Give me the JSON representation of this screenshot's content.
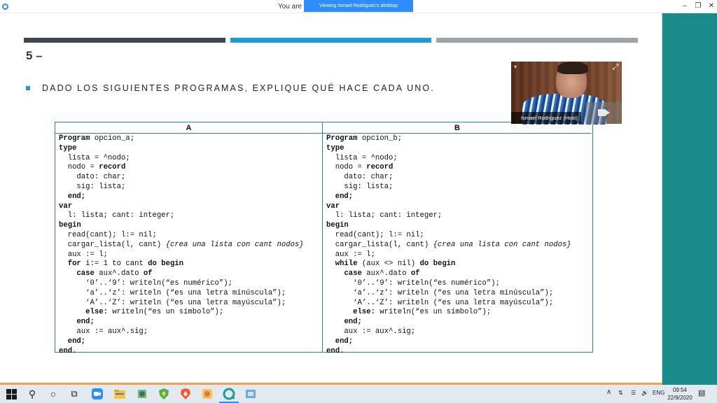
{
  "window": {
    "title_text": "You are v",
    "viewing_banner": "Viewing Ismael Rodriguez's desktop",
    "minimize_glyph": "–",
    "maximize_glyph": "❐",
    "close_glyph": "✕"
  },
  "slide": {
    "number": "5 –",
    "instruction": "DADO LOS SIGUIENTES PROGRAMAS, EXPLIQUE QUÉ HACE CADA UNO.",
    "colors": {
      "bar_dark": "#3f4850",
      "bar_blue": "#1e9ad6",
      "bar_gray": "#9ea3a8",
      "accent": "#1a8b8a"
    }
  },
  "table": {
    "col_a_header": "A",
    "col_b_header": "B",
    "code_a": [
      [
        {
          "t": "Program",
          "k": 1
        },
        {
          "t": " opcion_a;"
        }
      ],
      [
        {
          "t": "type",
          "k": 1
        }
      ],
      [
        {
          "t": "  lista = ^nodo;"
        }
      ],
      [
        {
          "t": "  nodo = "
        },
        {
          "t": "record",
          "k": 1
        }
      ],
      [
        {
          "t": "    dato: char;"
        }
      ],
      [
        {
          "t": "    sig: lista;"
        }
      ],
      [
        {
          "t": "  "
        },
        {
          "t": "end;",
          "k": 1
        }
      ],
      [
        {
          "t": "var",
          "k": 1
        }
      ],
      [
        {
          "t": "  l: lista; cant: integer;"
        }
      ],
      [
        {
          "t": "begin",
          "k": 1
        }
      ],
      [
        {
          "t": "  read(cant); l:= nil;"
        }
      ],
      [
        {
          "t": "  cargar_lista(l, cant) "
        },
        {
          "t": "{crea una lista con cant nodos}",
          "c": 1
        }
      ],
      [
        {
          "t": "  aux := l;"
        }
      ],
      [
        {
          "t": "  "
        },
        {
          "t": "for",
          "k": 1
        },
        {
          "t": " i:= 1 to cant "
        },
        {
          "t": "do begin",
          "k": 1
        }
      ],
      [
        {
          "t": "    "
        },
        {
          "t": "case",
          "k": 1
        },
        {
          "t": " aux^.dato "
        },
        {
          "t": "of",
          "k": 1
        }
      ],
      [
        {
          "t": "      ‘0’..‘9’: writeln(“es numérico”);"
        }
      ],
      [
        {
          "t": "      ‘a’..‘z’: writeln (“es una letra minúscula”);"
        }
      ],
      [
        {
          "t": "      ‘A’..‘Z’: writeln (“es una letra mayúscula”);"
        }
      ],
      [
        {
          "t": "      "
        },
        {
          "t": "else:",
          "k": 1
        },
        {
          "t": " writeln(“es un símbolo”);"
        }
      ],
      [
        {
          "t": "    "
        },
        {
          "t": "end;",
          "k": 1
        }
      ],
      [
        {
          "t": "    aux := aux^.sig;"
        }
      ],
      [
        {
          "t": "  "
        },
        {
          "t": "end;",
          "k": 1
        }
      ],
      [
        {
          "t": "end.",
          "k": 1
        }
      ]
    ],
    "code_b": [
      [
        {
          "t": "Program",
          "k": 1
        },
        {
          "t": " opcion_b;"
        }
      ],
      [
        {
          "t": "type",
          "k": 1
        }
      ],
      [
        {
          "t": "  lista = ^nodo;"
        }
      ],
      [
        {
          "t": "  nodo = "
        },
        {
          "t": "record",
          "k": 1
        }
      ],
      [
        {
          "t": "    dato: char;"
        }
      ],
      [
        {
          "t": "    sig: lista;"
        }
      ],
      [
        {
          "t": "  "
        },
        {
          "t": "end;",
          "k": 1
        }
      ],
      [
        {
          "t": "var",
          "k": 1
        }
      ],
      [
        {
          "t": "  l: lista; cant: integer;"
        }
      ],
      [
        {
          "t": "begin",
          "k": 1
        }
      ],
      [
        {
          "t": "  read(cant); l:= nil;"
        }
      ],
      [
        {
          "t": "  cargar_lista(l, cant) "
        },
        {
          "t": "{crea una lista con cant nodos}",
          "c": 1
        }
      ],
      [
        {
          "t": "  aux := l;"
        }
      ],
      [
        {
          "t": "  "
        },
        {
          "t": "while",
          "k": 1
        },
        {
          "t": " (aux <> nil) "
        },
        {
          "t": "do begin",
          "k": 1
        }
      ],
      [
        {
          "t": "    "
        },
        {
          "t": "case",
          "k": 1
        },
        {
          "t": " aux^.dato "
        },
        {
          "t": "of",
          "k": 1
        }
      ],
      [
        {
          "t": "      ‘0’..‘9’: writeln(“es numérico”);"
        }
      ],
      [
        {
          "t": "      ‘a’..‘z’: writeln (“es una letra minúscula”);"
        }
      ],
      [
        {
          "t": "      ‘A’..‘Z’: writeln (“es una letra mayúscula”);"
        }
      ],
      [
        {
          "t": "      "
        },
        {
          "t": "else:",
          "k": 1
        },
        {
          "t": " writeln(“es un símbolo”);"
        }
      ],
      [
        {
          "t": "    "
        },
        {
          "t": "end;",
          "k": 1
        }
      ],
      [
        {
          "t": "    aux := aux^.sig;"
        }
      ],
      [
        {
          "t": "  "
        },
        {
          "t": "end;",
          "k": 1
        }
      ],
      [
        {
          "t": "end.",
          "k": 1
        }
      ]
    ]
  },
  "video": {
    "participant_label": "Ismael Rodriguez (Host)",
    "expand_glyph": "⤢",
    "menu_glyph": "▾"
  },
  "taskbar": {
    "search_glyph": "⚲",
    "cortana_glyph": "○",
    "taskview_glyph": "⧉",
    "tray_up_glyph": "∧",
    "network_glyph": "⇅",
    "wifi_glyph": "☰",
    "volume_glyph": "🔊",
    "notification_glyph": "▤",
    "language": "ENG",
    "time": "09:54",
    "date": "22/9/2020",
    "icons": [
      "windows-start-icon",
      "search-icon",
      "cortana-icon",
      "task-view-icon",
      "zoom-app-icon",
      "file-explorer-icon",
      "app-icon",
      "shield-browser-icon",
      "brave-browser-icon",
      "app-icon",
      "zoom-active-icon",
      "app-icon"
    ]
  }
}
